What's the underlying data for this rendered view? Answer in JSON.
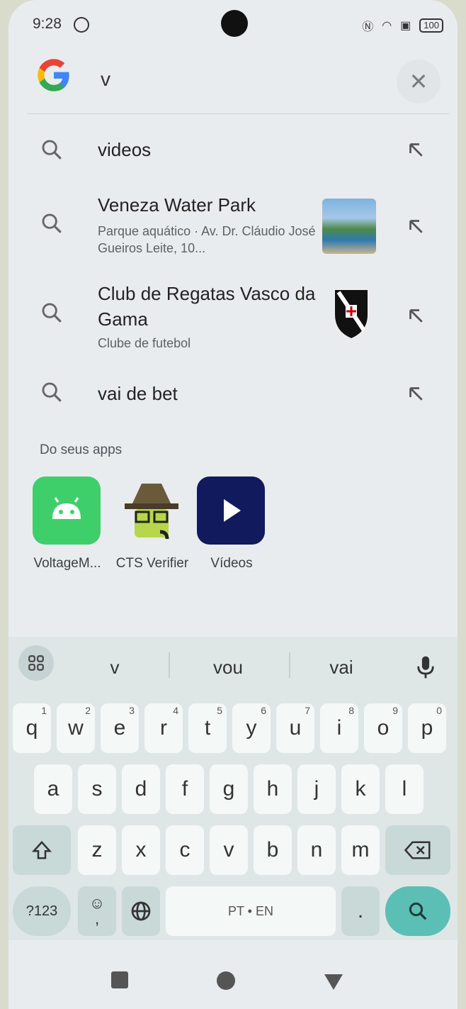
{
  "status_bar": {
    "time": "9:28",
    "battery": "100"
  },
  "search": {
    "query": "v",
    "clear_icon": "close-icon"
  },
  "suggestions": [
    {
      "title": "videos",
      "subtitle": ""
    },
    {
      "title": "Veneza Water Park",
      "subtitle": "Parque aquático · Av. Dr. Cláudio José Gueiros Leite, 10..."
    },
    {
      "title": "Club de Regatas Vasco da Gama",
      "subtitle": "Clube de futebol"
    },
    {
      "title": "vai de bet",
      "subtitle": ""
    }
  ],
  "apps_section": {
    "title": "Do seus apps",
    "apps": [
      {
        "label": "VoltageM...",
        "color": "#3ecf6b"
      },
      {
        "label": "CTS Verifier",
        "color": "#e9ecef"
      },
      {
        "label": "Vídeos",
        "color": "#101a5c"
      }
    ]
  },
  "keyboard": {
    "word_suggestions": [
      "v",
      "vou",
      "vai"
    ],
    "row1": [
      "q",
      "w",
      "e",
      "r",
      "t",
      "y",
      "u",
      "i",
      "o",
      "p"
    ],
    "row1_hints": [
      "1",
      "2",
      "3",
      "4",
      "5",
      "6",
      "7",
      "8",
      "9",
      "0"
    ],
    "row2": [
      "a",
      "s",
      "d",
      "f",
      "g",
      "h",
      "j",
      "k",
      "l"
    ],
    "row3": [
      "z",
      "x",
      "c",
      "v",
      "b",
      "n",
      "m"
    ],
    "symbols_key": "?123",
    "emoji_comma": ",",
    "space_label": "PT • EN",
    "period": ".",
    "accent_color": "#5bbfb6"
  }
}
